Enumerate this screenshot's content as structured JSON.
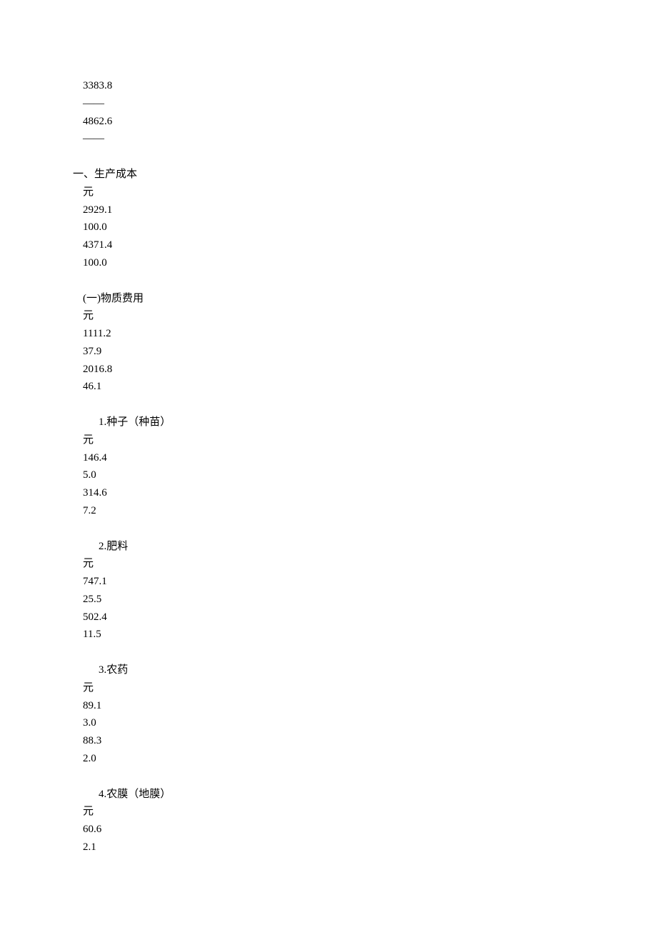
{
  "top_block": {
    "v1": "3383.8",
    "v2": "——",
    "v3": "4862.6",
    "v4": "——"
  },
  "sections": [
    {
      "label": "一、生产成本",
      "label_class": "label-main",
      "unit": "元",
      "v1": "2929.1",
      "v2": "100.0",
      "v3": "4371.4",
      "v4": "100.0"
    },
    {
      "label": "(一)物质费用",
      "label_class": "label-sub1",
      "unit": "元",
      "v1": "1111.2",
      "v2": "37.9",
      "v3": "2016.8",
      "v4": "46.1"
    },
    {
      "label": "1.种子（种苗）",
      "label_class": "label-sub2",
      "unit": "元",
      "v1": "146.4",
      "v2": "5.0",
      "v3": "314.6",
      "v4": "7.2"
    },
    {
      "label": "2.肥料",
      "label_class": "label-sub2",
      "unit": "元",
      "v1": "747.1",
      "v2": "25.5",
      "v3": "502.4",
      "v4": "11.5"
    },
    {
      "label": "3.农药",
      "label_class": "label-sub2",
      "unit": "元",
      "v1": "89.1",
      "v2": "3.0",
      "v3": "88.3",
      "v4": "2.0"
    },
    {
      "label": "4.农膜（地膜）",
      "label_class": "label-sub2",
      "unit": "元",
      "v1": "60.6",
      "v2": "2.1"
    }
  ]
}
